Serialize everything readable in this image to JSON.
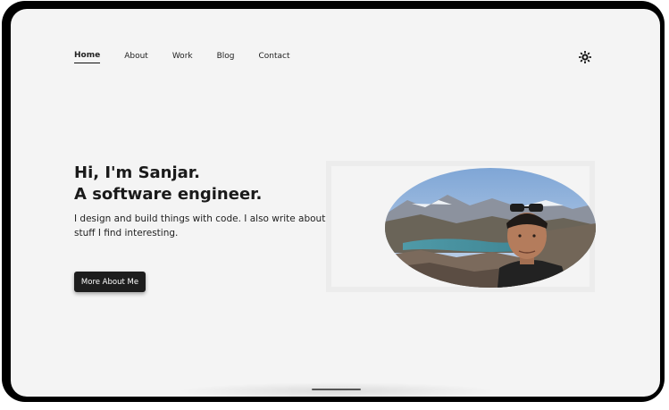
{
  "nav": {
    "items": [
      {
        "label": "Home",
        "active": true
      },
      {
        "label": "About",
        "active": false
      },
      {
        "label": "Work",
        "active": false
      },
      {
        "label": "Blog",
        "active": false
      },
      {
        "label": "Contact",
        "active": false
      }
    ],
    "theme_toggle_icon": "sun-icon"
  },
  "hero": {
    "title_line1": "Hi, I'm Sanjar.",
    "title_line2": "A software engineer.",
    "description": "I design and build things with code. I also write about stuff I find interesting.",
    "cta_label": "More About Me",
    "photo_icon": "profile-photo"
  },
  "colors": {
    "background": "#f4f4f4",
    "text": "#1a1a1a",
    "button": "#1d1d1d",
    "device_frame": "#000000"
  }
}
